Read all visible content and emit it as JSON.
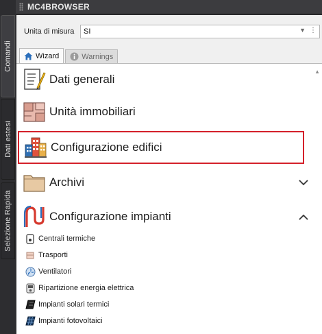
{
  "window": {
    "title": "MC4BROWSER"
  },
  "side_tabs": [
    {
      "label": "Comandi"
    },
    {
      "label": "Dati estesi"
    },
    {
      "label": "Selezione Rapida"
    }
  ],
  "unit": {
    "label": "Unita di misura",
    "value": "SI"
  },
  "tabs": [
    {
      "label": "Wizard",
      "icon": "home-icon"
    },
    {
      "label": "Warnings",
      "icon": "info-icon"
    }
  ],
  "items": [
    {
      "label": "Dati generali",
      "icon": "document-edit-icon"
    },
    {
      "label": "Unità immobiliari",
      "icon": "floorplan-icon"
    },
    {
      "label": "Configurazione edifici",
      "icon": "buildings-icon"
    },
    {
      "label": "Archivi",
      "icon": "folder-icon",
      "state": "collapsed"
    },
    {
      "label": "Configurazione impianti",
      "icon": "pipes-icon",
      "state": "expanded"
    }
  ],
  "subitems": [
    {
      "label": "Centrali termiche",
      "icon": "boiler-icon"
    },
    {
      "label": "Trasporti",
      "icon": "transport-icon"
    },
    {
      "label": "Ventilatori",
      "icon": "fan-icon"
    },
    {
      "label": "Ripartizione energia elettrica",
      "icon": "electric-meter-icon"
    },
    {
      "label": "Impianti solari termici",
      "icon": "solar-thermal-icon"
    },
    {
      "label": "Impianti fotovoltaici",
      "icon": "photovoltaic-icon"
    }
  ],
  "colors": {
    "selection_border": "#d4202a",
    "accent": "#2a6ebb"
  }
}
